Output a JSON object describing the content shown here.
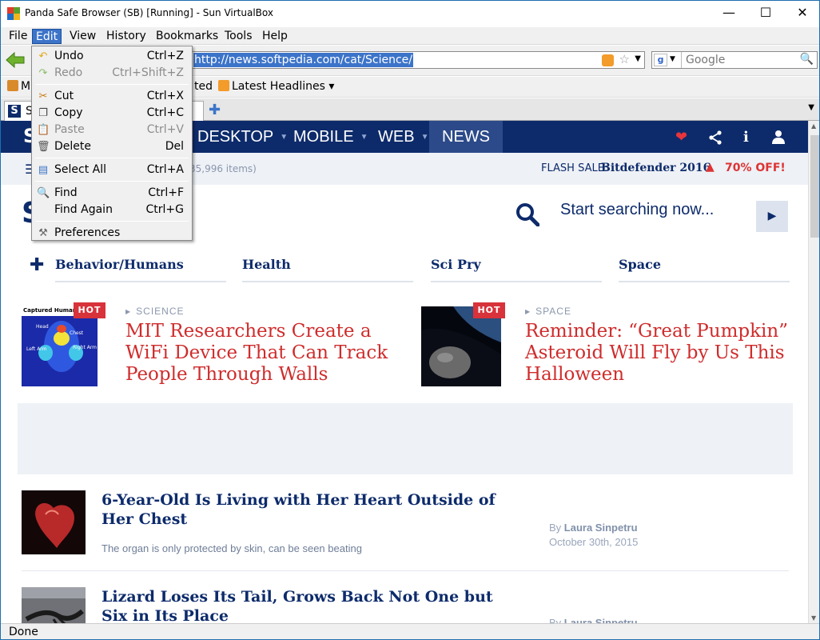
{
  "window": {
    "title": "Panda Safe Browser (SB) [Running] - Sun VirtualBox",
    "minimize": "—",
    "maximize": "☐",
    "close": "✕"
  },
  "menubar": {
    "items": [
      "File",
      "Edit",
      "View",
      "History",
      "Bookmarks",
      "Tools",
      "Help"
    ]
  },
  "nav": {
    "url": "http://news.softpedia.com/cat/Science/",
    "search_placeholder": "Google"
  },
  "bookmarks": {
    "item1": "M",
    "item2": "ted",
    "latest": "Latest Headlines"
  },
  "tabs": {
    "current_label": "S"
  },
  "edit_menu": {
    "items": [
      {
        "label": "Undo",
        "shortcut": "Ctrl+Z",
        "disabled": false,
        "icon": "undo-icon"
      },
      {
        "label": "Redo",
        "shortcut": "Ctrl+Shift+Z",
        "disabled": true,
        "icon": "redo-icon"
      },
      {
        "label": "Cut",
        "shortcut": "Ctrl+X",
        "disabled": false,
        "icon": "scissors-icon"
      },
      {
        "label": "Copy",
        "shortcut": "Ctrl+C",
        "disabled": false,
        "icon": "copy-icon"
      },
      {
        "label": "Paste",
        "shortcut": "Ctrl+V",
        "disabled": true,
        "icon": "paste-icon"
      },
      {
        "label": "Delete",
        "shortcut": "Del",
        "disabled": false,
        "icon": "trash-icon"
      },
      {
        "label": "Select All",
        "shortcut": "Ctrl+A",
        "disabled": false,
        "icon": "select-all-icon"
      },
      {
        "label": "Find",
        "shortcut": "Ctrl+F",
        "disabled": false,
        "icon": "magnifier-icon"
      },
      {
        "label": "Find Again",
        "shortcut": "Ctrl+G",
        "disabled": false,
        "icon": ""
      },
      {
        "label": "Preferences",
        "shortcut": "",
        "disabled": false,
        "icon": "tools-icon"
      }
    ]
  },
  "site": {
    "logo": "S",
    "nav_items": [
      "DESKTOP",
      "MOBILE",
      "WEB",
      "NEWS"
    ],
    "active_nav": "NEWS",
    "item_count": "35,996 items)",
    "flash_sale_label": "FLASH SALE:",
    "flash_sale_product": "Bitdefender 2016",
    "flash_sale_offer": "70% OFF!",
    "page_heading": "S",
    "search_placeholder": "Start searching now...",
    "categories": [
      "Behavior/Humans",
      "Health",
      "Sci Pry",
      "Space"
    ],
    "featured": [
      {
        "badge": "HOT",
        "kicker": "SCIENCE",
        "title": "MIT Researchers Create a WiFi Device That Can Track People Through Walls",
        "image_caption": "Captured Human",
        "labels": [
          "Head",
          "Chest",
          "Left Arm",
          "Right Arm"
        ]
      },
      {
        "badge": "HOT",
        "kicker": "SPACE",
        "title": "Reminder: “Great Pumpkin” Asteroid Will Fly by Us This Halloween"
      }
    ],
    "articles": [
      {
        "title": "6-Year-Old Is Living with Her Heart Outside of Her Chest",
        "subtitle": "The organ is only protected by skin, can be seen beating",
        "by": "By",
        "author": "Laura Sinpetru",
        "date": "October 30th, 2015"
      },
      {
        "title": "Lizard Loses Its Tail, Grows Back Not One but Six in Its Place",
        "subtitle": "",
        "by": "By",
        "author": "Laura Sinpetru",
        "date": ""
      }
    ]
  },
  "status": {
    "text": "Done"
  },
  "colors": {
    "site_navy": "#0d2b6b",
    "headline_red": "#cf2c2c",
    "menu_highlight": "#3c74c9"
  }
}
